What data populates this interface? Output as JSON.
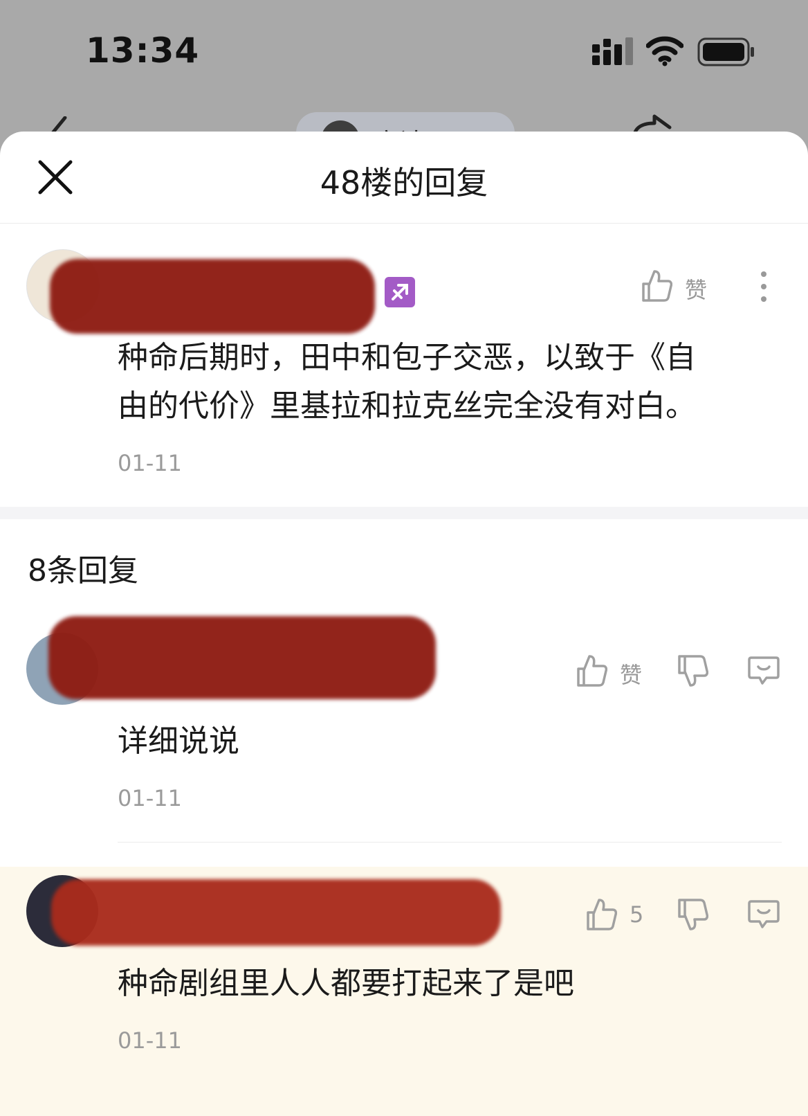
{
  "status_bar": {
    "time": "13:34"
  },
  "background_nav": {
    "bar_label": "高达吧"
  },
  "sheet": {
    "title": "48楼的回复"
  },
  "main_post": {
    "text_line1": "种命后期时，田中和包子交恶，以致于《自",
    "text_line2": "由的代价》里基拉和拉克丝完全没有对白。",
    "date": "01-11",
    "like_label": "赞",
    "badge_icon": "sagittarius-icon"
  },
  "replies": {
    "count_label": "8条回复",
    "items": [
      {
        "text": "详细说说",
        "date": "01-11",
        "like_label": "赞"
      },
      {
        "text": "种命剧组里人人都要打起来了是吧",
        "date": "01-11",
        "like_label": "5"
      }
    ]
  },
  "colors": {
    "redaction": "#8e1c12",
    "highlight_bg": "#fdf8eb",
    "badge": "#a35bc6",
    "icon_gray": "#9a9a9a"
  }
}
